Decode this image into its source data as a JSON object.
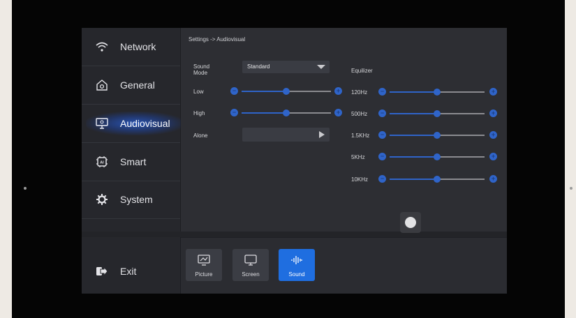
{
  "breadcrumb": "Settings -> Audiovisual",
  "sidebar": {
    "items": [
      {
        "label": "Network",
        "icon": "wifi-icon"
      },
      {
        "label": "General",
        "icon": "home-settings-icon"
      },
      {
        "label": "Audiovisual",
        "icon": "monitor-icon"
      },
      {
        "label": "Smart",
        "icon": "ai-chip-icon"
      },
      {
        "label": "System",
        "icon": "gear-icon"
      }
    ],
    "exit_label": "Exit",
    "active": "Audiovisual"
  },
  "sound": {
    "sound_mode_label": "Sound\nMode",
    "sound_mode_value": "Standard",
    "low_label": "Low",
    "low_level": 0.5,
    "high_label": "High",
    "high_level": 0.5,
    "alone_label": "Alone"
  },
  "equalizer": {
    "title": "Equilizer",
    "bands": [
      {
        "label": "120Hz",
        "level": 0.5
      },
      {
        "label": "500Hz",
        "level": 0.5
      },
      {
        "label": "1.5KHz",
        "level": 0.5
      },
      {
        "label": "5KHz",
        "level": 0.5
      },
      {
        "label": "10KHz",
        "level": 0.5
      }
    ]
  },
  "tabs": [
    {
      "label": "Picture",
      "icon": "picture-icon"
    },
    {
      "label": "Screen",
      "icon": "screen-icon"
    },
    {
      "label": "Sound",
      "icon": "sound-wave-icon",
      "active": true
    }
  ],
  "colors": {
    "accent": "#1f6ee0",
    "slider": "#2f64c9",
    "panel": "#2d2e33"
  }
}
